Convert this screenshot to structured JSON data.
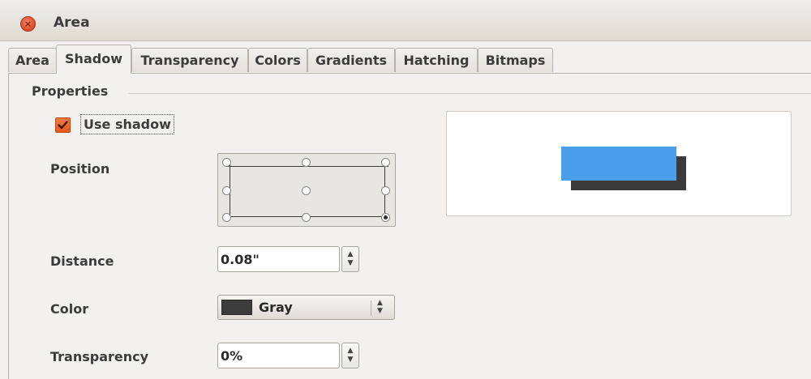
{
  "window": {
    "title": "Area",
    "close_icon": "close-icon"
  },
  "tabs": [
    {
      "label": "Area",
      "active": false
    },
    {
      "label": "Shadow",
      "active": true
    },
    {
      "label": "Transparency",
      "active": false
    },
    {
      "label": "Colors",
      "active": false
    },
    {
      "label": "Gradients",
      "active": false
    },
    {
      "label": "Hatching",
      "active": false
    },
    {
      "label": "Bitmaps",
      "active": false
    }
  ],
  "properties": {
    "section_title": "Properties",
    "use_shadow": {
      "label": "Use shadow",
      "checked": true
    },
    "position": {
      "label": "Position",
      "selected": "bottom-right"
    },
    "distance": {
      "label": "Distance",
      "value": "0.08\""
    },
    "color": {
      "label": "Color",
      "value": "Gray",
      "swatch": "#3c3c3c"
    },
    "transparency": {
      "label": "Transparency",
      "value": "0%"
    }
  },
  "preview": {
    "object_color": "#4a9eea",
    "shadow_color": "#3b3b3b"
  },
  "colors": {
    "accent": "#e8591a",
    "dialog_bg": "#f2f1f0"
  }
}
